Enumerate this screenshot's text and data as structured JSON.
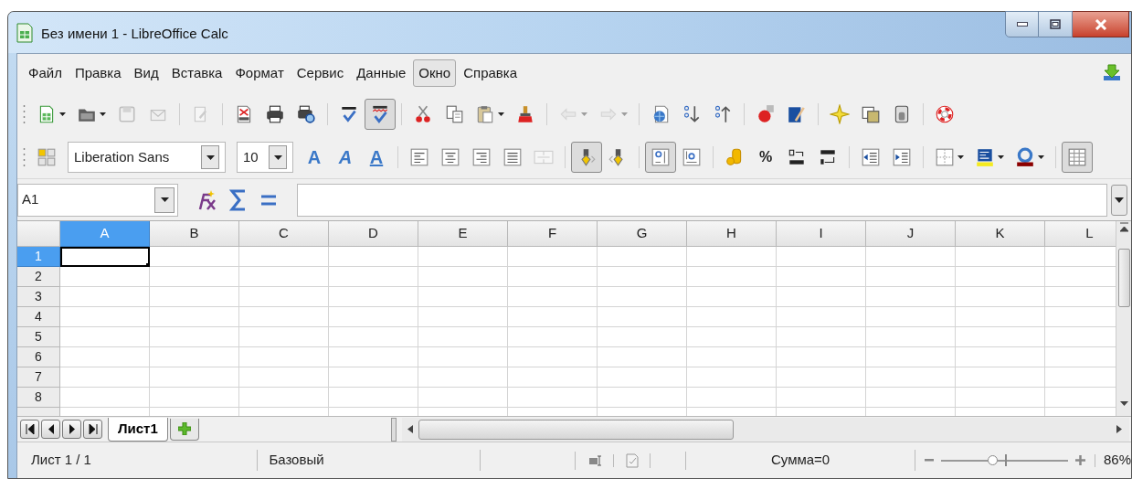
{
  "window": {
    "title": "Без имени 1 - LibreOffice Calc"
  },
  "menu": [
    {
      "label": "Файл",
      "highlighted": false
    },
    {
      "label": "Правка",
      "highlighted": false
    },
    {
      "label": "Вид",
      "highlighted": false
    },
    {
      "label": "Вставка",
      "highlighted": false
    },
    {
      "label": "Формат",
      "highlighted": false
    },
    {
      "label": "Сервис",
      "highlighted": false
    },
    {
      "label": "Данные",
      "highlighted": false
    },
    {
      "label": "Окно",
      "highlighted": true
    },
    {
      "label": "Справка",
      "highlighted": false
    }
  ],
  "toolbar_1": [
    {
      "kind": "new",
      "dropdown": true,
      "pressed": false,
      "disabled": false
    },
    {
      "kind": "open",
      "dropdown": true,
      "pressed": false,
      "disabled": false
    },
    {
      "kind": "save",
      "dropdown": false,
      "pressed": false,
      "disabled": true
    },
    {
      "kind": "mail",
      "dropdown": false,
      "pressed": false,
      "disabled": true
    },
    {
      "kind": "separator"
    },
    {
      "kind": "edit",
      "dropdown": false,
      "pressed": false,
      "disabled": true
    },
    {
      "kind": "separator"
    },
    {
      "kind": "pdf",
      "dropdown": false,
      "pressed": false,
      "disabled": false
    },
    {
      "kind": "print",
      "dropdown": false,
      "pressed": false,
      "disabled": false
    },
    {
      "kind": "preview",
      "dropdown": false,
      "pressed": false,
      "disabled": false
    },
    {
      "kind": "separator"
    },
    {
      "kind": "spelling",
      "dropdown": false,
      "pressed": false,
      "disabled": false
    },
    {
      "kind": "autospell",
      "dropdown": false,
      "pressed": true,
      "disabled": false
    },
    {
      "kind": "separator"
    },
    {
      "kind": "cut",
      "dropdown": false,
      "pressed": false,
      "disabled": false
    },
    {
      "kind": "copy",
      "dropdown": false,
      "pressed": false,
      "disabled": false
    },
    {
      "kind": "paste",
      "dropdown": true,
      "pressed": false,
      "disabled": false
    },
    {
      "kind": "brush",
      "dropdown": false,
      "pressed": false,
      "disabled": false
    },
    {
      "kind": "separator"
    },
    {
      "kind": "undo",
      "dropdown": true,
      "pressed": false,
      "disabled": true
    },
    {
      "kind": "redo",
      "dropdown": true,
      "pressed": false,
      "disabled": true
    },
    {
      "kind": "separator"
    },
    {
      "kind": "hyperlink",
      "dropdown": false,
      "pressed": false,
      "disabled": false
    },
    {
      "kind": "sortasc",
      "dropdown": false,
      "pressed": false,
      "disabled": false
    },
    {
      "kind": "sortdesc",
      "dropdown": false,
      "pressed": false,
      "disabled": false
    },
    {
      "kind": "separator"
    },
    {
      "kind": "chart",
      "dropdown": false,
      "pressed": false,
      "disabled": false
    },
    {
      "kind": "draw",
      "dropdown": false,
      "pressed": false,
      "disabled": false
    },
    {
      "kind": "separator"
    },
    {
      "kind": "navigator",
      "dropdown": false,
      "pressed": false,
      "disabled": false
    },
    {
      "kind": "gallery",
      "dropdown": false,
      "pressed": false,
      "disabled": false
    },
    {
      "kind": "datasources",
      "dropdown": false,
      "pressed": false,
      "disabled": false
    },
    {
      "kind": "separator"
    },
    {
      "kind": "help",
      "dropdown": false,
      "pressed": false,
      "disabled": false
    }
  ],
  "toolbar_2": [
    {
      "kind": "styles",
      "dropdown": false,
      "pressed": false,
      "disabled": false
    },
    {
      "kind": "font",
      "value": "Liberation Sans"
    },
    {
      "kind": "size",
      "value": "10"
    },
    {
      "kind": "bold",
      "glyph": "A",
      "dropdown": false,
      "pressed": false,
      "disabled": false
    },
    {
      "kind": "italic",
      "glyph": "A",
      "dropdown": false,
      "pressed": false,
      "disabled": false
    },
    {
      "kind": "underline",
      "glyph": "A",
      "dropdown": false,
      "pressed": false,
      "disabled": false
    },
    {
      "kind": "separator"
    },
    {
      "kind": "alignleft",
      "dropdown": false,
      "pressed": false,
      "disabled": false
    },
    {
      "kind": "aligncenter",
      "dropdown": false,
      "pressed": false,
      "disabled": false
    },
    {
      "kind": "alignright",
      "dropdown": false,
      "pressed": false,
      "disabled": false
    },
    {
      "kind": "justify",
      "dropdown": false,
      "pressed": false,
      "disabled": false
    },
    {
      "kind": "merge",
      "dropdown": false,
      "pressed": false,
      "disabled": true
    },
    {
      "kind": "separator"
    },
    {
      "kind": "ltr",
      "dropdown": false,
      "pressed": true,
      "disabled": false
    },
    {
      "kind": "rtl",
      "dropdown": false,
      "pressed": false,
      "disabled": false
    },
    {
      "kind": "separator"
    },
    {
      "kind": "wraptop",
      "dropdown": false,
      "pressed": true,
      "disabled": false
    },
    {
      "kind": "wrapbottom",
      "dropdown": false,
      "pressed": false,
      "disabled": false
    },
    {
      "kind": "separator"
    },
    {
      "kind": "currency",
      "dropdown": false,
      "pressed": false,
      "disabled": false
    },
    {
      "kind": "percent",
      "glyph": "%",
      "dropdown": false,
      "pressed": false,
      "disabled": false
    },
    {
      "kind": "adddecimal",
      "dropdown": false,
      "pressed": false,
      "disabled": false
    },
    {
      "kind": "deldecimal",
      "dropdown": false,
      "pressed": false,
      "disabled": false
    },
    {
      "kind": "separator"
    },
    {
      "kind": "outdent",
      "dropdown": false,
      "pressed": false,
      "disabled": false
    },
    {
      "kind": "indent",
      "dropdown": false,
      "pressed": false,
      "disabled": false
    },
    {
      "kind": "separator"
    },
    {
      "kind": "borders",
      "dropdown": true,
      "pressed": false,
      "disabled": false
    },
    {
      "kind": "bgcolor",
      "dropdown": true,
      "pressed": false,
      "disabled": false
    },
    {
      "kind": "fontcolor",
      "dropdown": true,
      "pressed": false,
      "disabled": false
    },
    {
      "kind": "separator"
    },
    {
      "kind": "gridlines",
      "dropdown": false,
      "pressed": true,
      "disabled": false
    }
  ],
  "formula_bar": {
    "name_box": "A1"
  },
  "columns": [
    {
      "label": "A",
      "selected": true
    },
    {
      "label": "B",
      "selected": false
    },
    {
      "label": "C",
      "selected": false
    },
    {
      "label": "D",
      "selected": false
    },
    {
      "label": "E",
      "selected": false
    },
    {
      "label": "F",
      "selected": false
    },
    {
      "label": "G",
      "selected": false
    },
    {
      "label": "H",
      "selected": false
    },
    {
      "label": "I",
      "selected": false
    },
    {
      "label": "J",
      "selected": false
    },
    {
      "label": "K",
      "selected": false
    },
    {
      "label": "L",
      "selected": false
    }
  ],
  "rows": [
    {
      "label": "1",
      "selected": true
    },
    {
      "label": "2",
      "selected": false
    },
    {
      "label": "3",
      "selected": false
    },
    {
      "label": "4",
      "selected": false
    },
    {
      "label": "5",
      "selected": false
    },
    {
      "label": "6",
      "selected": false
    },
    {
      "label": "7",
      "selected": false
    },
    {
      "label": "8",
      "selected": false
    }
  ],
  "sheet_tabs": [
    {
      "label": "Лист1",
      "selected": true
    }
  ],
  "status_bar": {
    "sheet_position": "Лист 1 / 1",
    "page_style": "Базовый",
    "sum": "Сумма=0",
    "zoom": {
      "level": 0.4,
      "reading": "86%"
    }
  }
}
